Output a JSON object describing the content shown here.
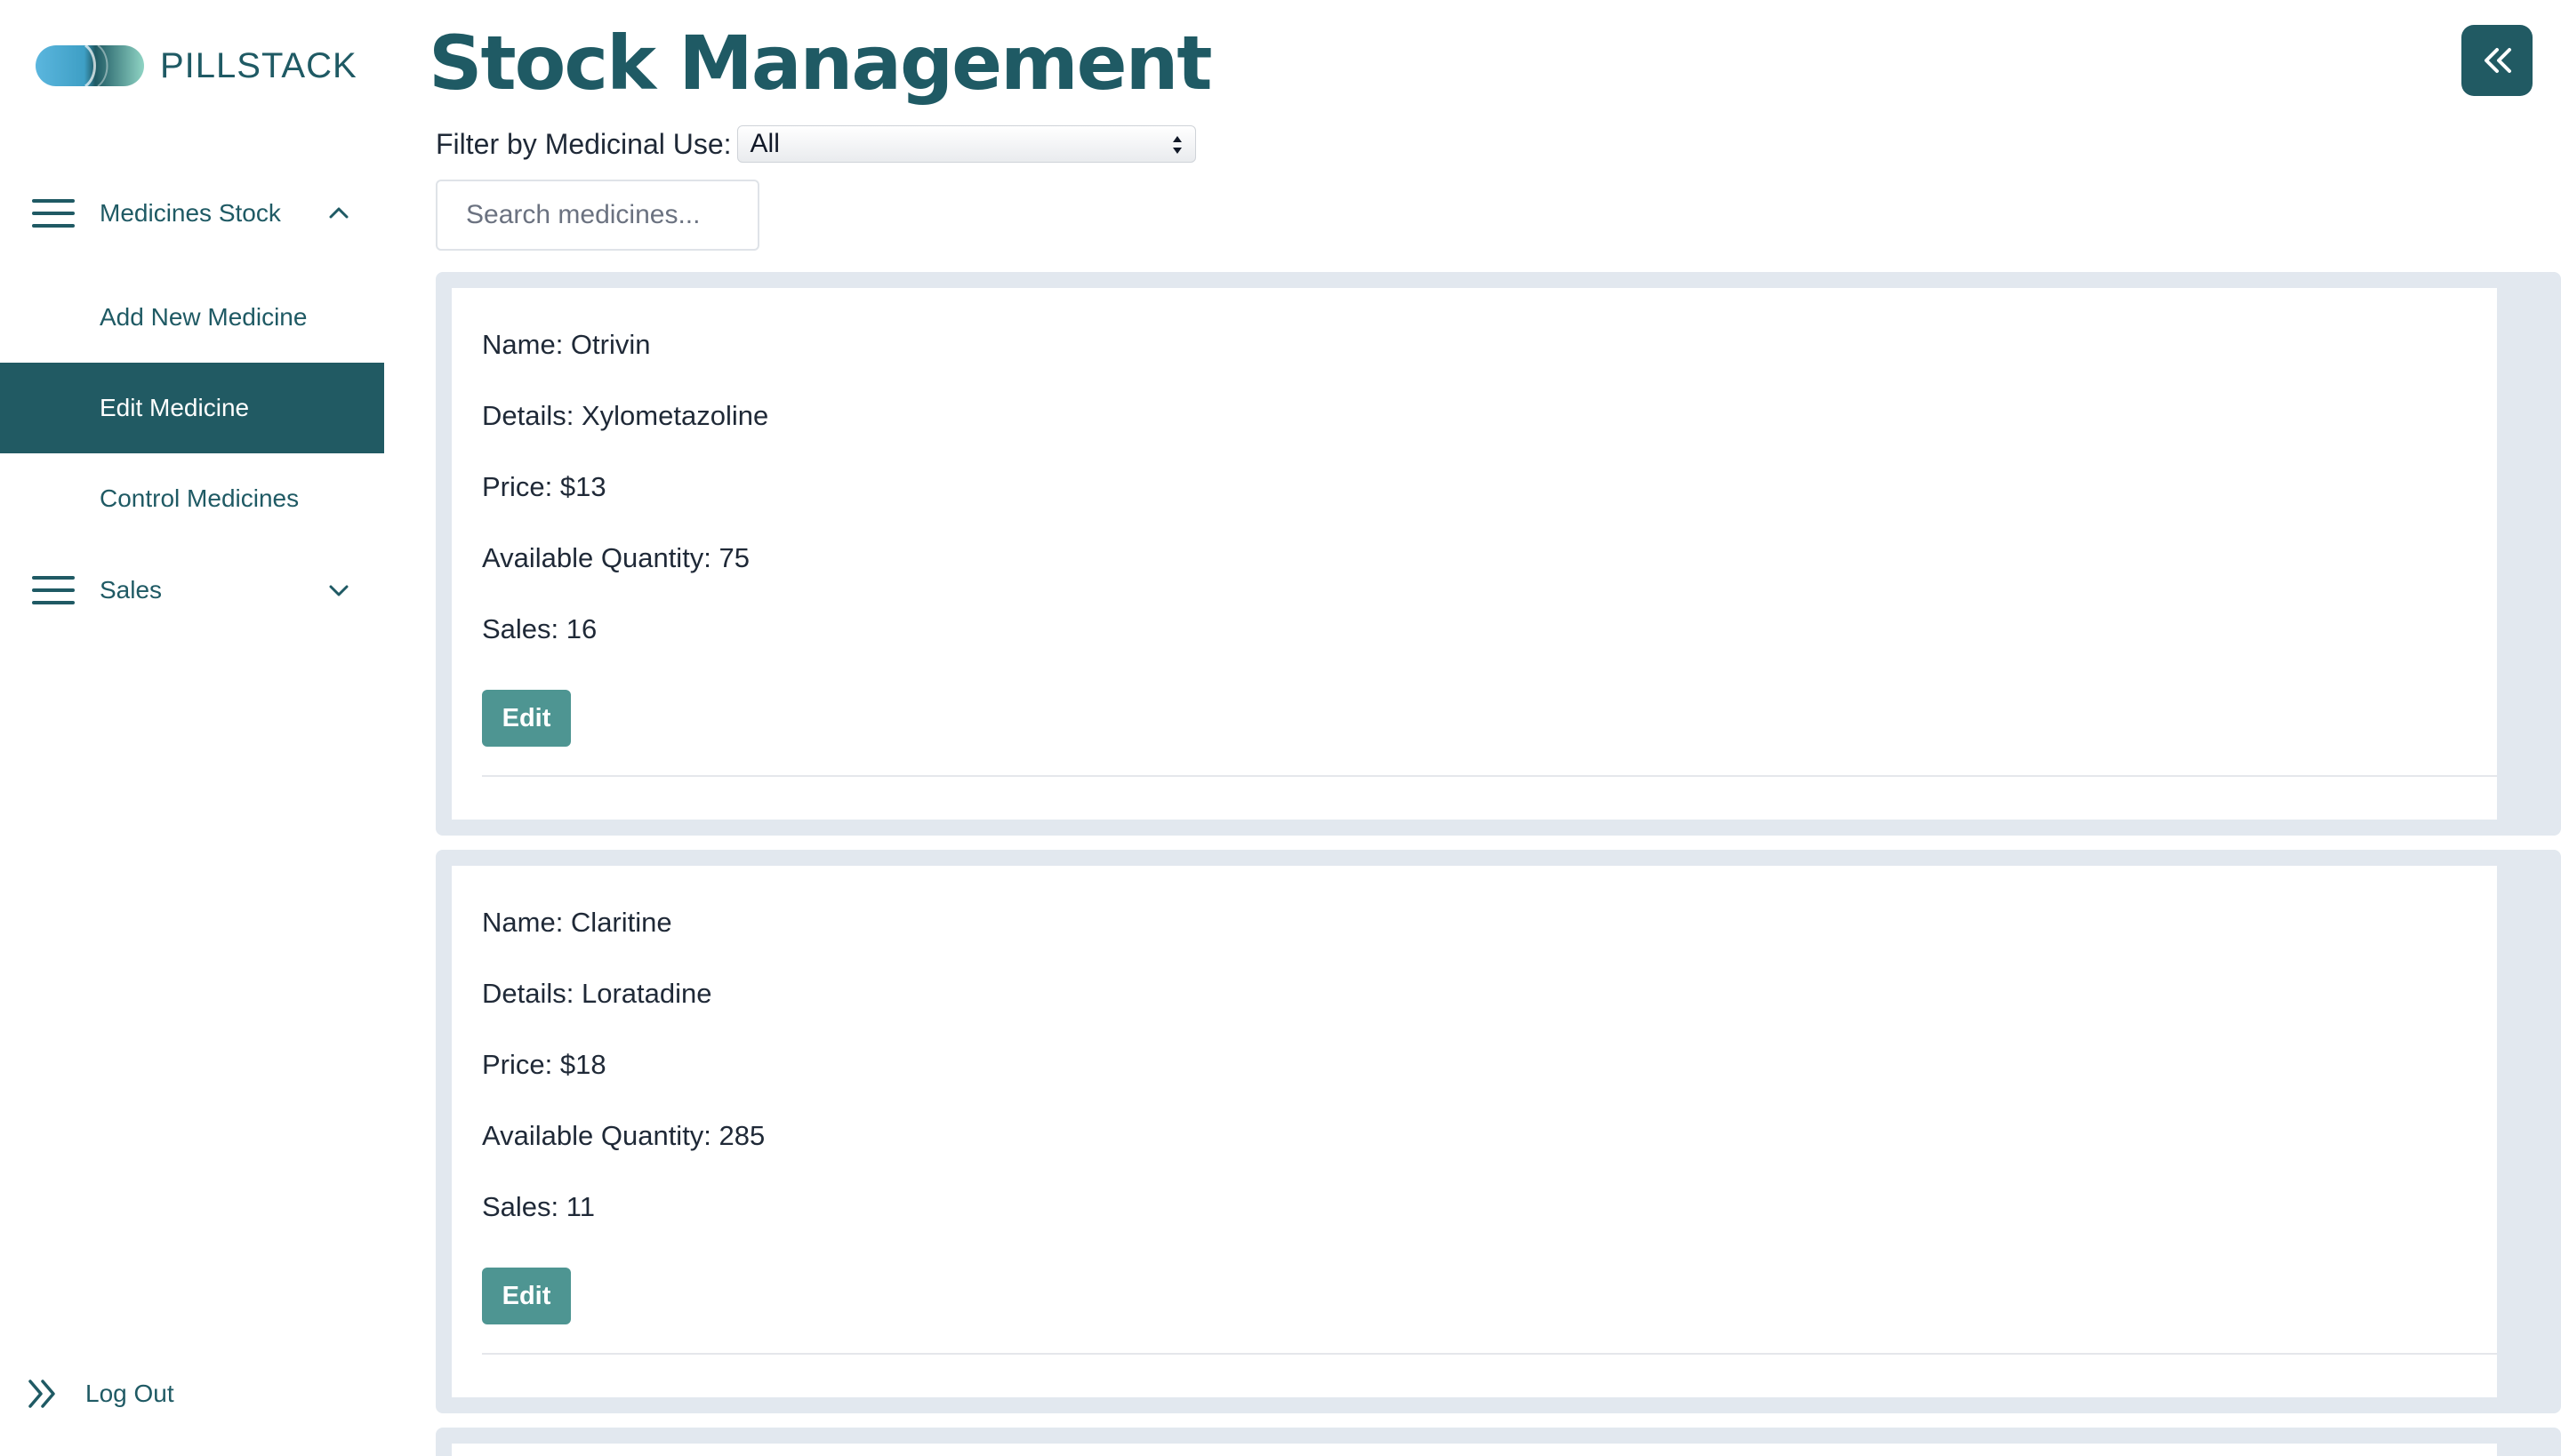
{
  "brand": {
    "name": "PILLSTACK"
  },
  "sidebar": {
    "groups": [
      {
        "label": "Medicines Stock",
        "expanded": true
      },
      {
        "label": "Sales",
        "expanded": false
      }
    ],
    "items": [
      {
        "label": "Add New Medicine",
        "active": false
      },
      {
        "label": "Edit Medicine",
        "active": true
      },
      {
        "label": "Control Medicines",
        "active": false
      }
    ],
    "logout_label": "Log Out"
  },
  "header": {
    "title": "Stock Management"
  },
  "filter": {
    "label": "Filter by Medicinal Use:",
    "selected": "All"
  },
  "search": {
    "placeholder": "Search medicines..."
  },
  "medicines": [
    {
      "name": "Name: Otrivin",
      "details": "Details: Xylometazoline",
      "price": "Price: $13",
      "quantity": "Available Quantity: 75",
      "sales": "Sales: 16",
      "edit_label": "Edit"
    },
    {
      "name": "Name: Claritine",
      "details": "Details: Loratadine",
      "price": "Price: $18",
      "quantity": "Available Quantity: 285",
      "sales": "Sales: 11",
      "edit_label": "Edit"
    }
  ],
  "colors": {
    "accent": "#215a63",
    "button": "#4e9592",
    "card_border": "#e2e8ef"
  }
}
